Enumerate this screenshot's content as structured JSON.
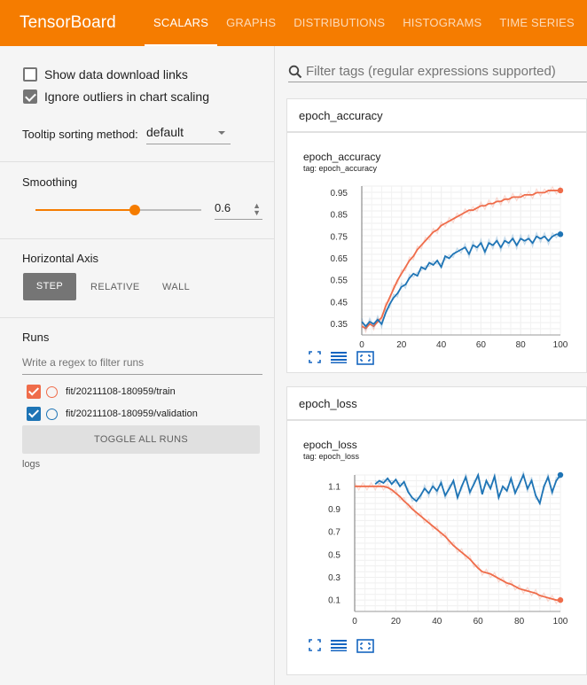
{
  "app": {
    "title": "TensorBoard"
  },
  "tabs": [
    {
      "label": "SCALARS",
      "active": true
    },
    {
      "label": "GRAPHS",
      "active": false
    },
    {
      "label": "DISTRIBUTIONS",
      "active": false
    },
    {
      "label": "HISTOGRAMS",
      "active": false
    },
    {
      "label": "TIME SERIES",
      "active": false
    }
  ],
  "sidebar": {
    "show_download_label": "Show data download links",
    "show_download_checked": false,
    "ignore_outliers_label": "Ignore outliers in chart scaling",
    "ignore_outliers_checked": true,
    "tooltip_label": "Tooltip sorting method:",
    "tooltip_value": "default",
    "smoothing_label": "Smoothing",
    "smoothing_value": "0.6",
    "smoothing_fraction": 0.6,
    "horizontal_axis_label": "Horizontal Axis",
    "axis_options": [
      "STEP",
      "RELATIVE",
      "WALL"
    ],
    "axis_selected": "STEP",
    "runs_label": "Runs",
    "runs_filter_placeholder": "Write a regex to filter runs",
    "runs": [
      {
        "name": "fit/20211108-180959/train",
        "color": "#ef6c4a",
        "checked": true
      },
      {
        "name": "fit/20211108-180959/validation",
        "color": "#1e74b5",
        "checked": true
      }
    ],
    "toggle_all_label": "TOGGLE ALL RUNS",
    "logs_label": "logs"
  },
  "main": {
    "search_placeholder": "Filter tags (regular expressions supported)"
  },
  "colors": {
    "accent": "#f57c00",
    "train": "#ef6c4a",
    "validation": "#1e74b5"
  },
  "chart_data": [
    {
      "type": "line",
      "group": "epoch_accuracy",
      "title": "epoch_accuracy",
      "subtitle": "tag: epoch_accuracy",
      "xlim": [
        0,
        100
      ],
      "ylim": [
        0.3,
        0.98
      ],
      "xticks": [
        0,
        20,
        40,
        60,
        80,
        100
      ],
      "yticks": [
        0.35,
        0.45,
        0.55,
        0.65,
        0.75,
        0.85,
        0.95
      ],
      "ytick_labels": [
        "0.35",
        "0.45",
        "0.55",
        "0.65",
        "0.75",
        "0.85",
        "0.95"
      ],
      "grid": true,
      "series": [
        {
          "name": "fit/20211108-180959/train",
          "color": "#ef6c4a",
          "x": [
            0,
            2,
            4,
            6,
            8,
            10,
            12,
            14,
            16,
            18,
            20,
            22,
            24,
            26,
            28,
            30,
            32,
            34,
            36,
            38,
            40,
            42,
            44,
            46,
            48,
            50,
            52,
            54,
            56,
            58,
            60,
            62,
            64,
            66,
            68,
            70,
            72,
            74,
            76,
            78,
            80,
            82,
            84,
            86,
            88,
            90,
            92,
            94,
            96,
            98,
            100
          ],
          "y": [
            0.34,
            0.33,
            0.35,
            0.34,
            0.36,
            0.38,
            0.43,
            0.47,
            0.51,
            0.55,
            0.58,
            0.61,
            0.64,
            0.66,
            0.69,
            0.71,
            0.73,
            0.75,
            0.77,
            0.78,
            0.8,
            0.81,
            0.82,
            0.83,
            0.84,
            0.85,
            0.86,
            0.87,
            0.87,
            0.88,
            0.89,
            0.89,
            0.9,
            0.9,
            0.91,
            0.91,
            0.92,
            0.92,
            0.93,
            0.93,
            0.93,
            0.94,
            0.94,
            0.94,
            0.95,
            0.95,
            0.95,
            0.96,
            0.96,
            0.96,
            0.96
          ]
        },
        {
          "name": "fit/20211108-180959/validation",
          "color": "#1e74b5",
          "x": [
            0,
            2,
            4,
            6,
            8,
            10,
            12,
            14,
            16,
            18,
            20,
            22,
            24,
            26,
            28,
            30,
            32,
            34,
            36,
            38,
            40,
            42,
            44,
            46,
            48,
            50,
            52,
            54,
            56,
            58,
            60,
            62,
            64,
            66,
            68,
            70,
            72,
            74,
            76,
            78,
            80,
            82,
            84,
            86,
            88,
            90,
            92,
            94,
            96,
            98,
            100
          ],
          "y": [
            0.36,
            0.34,
            0.36,
            0.35,
            0.37,
            0.35,
            0.4,
            0.44,
            0.47,
            0.49,
            0.52,
            0.53,
            0.56,
            0.58,
            0.57,
            0.61,
            0.6,
            0.63,
            0.62,
            0.64,
            0.61,
            0.66,
            0.65,
            0.67,
            0.68,
            0.69,
            0.7,
            0.67,
            0.71,
            0.7,
            0.72,
            0.68,
            0.72,
            0.71,
            0.73,
            0.7,
            0.73,
            0.72,
            0.74,
            0.71,
            0.74,
            0.73,
            0.74,
            0.72,
            0.75,
            0.74,
            0.75,
            0.73,
            0.75,
            0.76,
            0.76
          ]
        }
      ]
    },
    {
      "type": "line",
      "group": "epoch_loss",
      "title": "epoch_loss",
      "subtitle": "tag: epoch_loss",
      "xlim": [
        0,
        100
      ],
      "ylim": [
        0.0,
        1.2
      ],
      "xticks": [
        0,
        20,
        40,
        60,
        80,
        100
      ],
      "yticks": [
        0.1,
        0.3,
        0.5,
        0.7,
        0.9,
        1.1
      ],
      "ytick_labels": [
        "0.1",
        "0.3",
        "0.5",
        "0.7",
        "0.9",
        "1.1"
      ],
      "grid": true,
      "series": [
        {
          "name": "fit/20211108-180959/train",
          "color": "#ef6c4a",
          "x": [
            0,
            2,
            4,
            6,
            8,
            10,
            12,
            14,
            16,
            18,
            20,
            22,
            24,
            26,
            28,
            30,
            32,
            34,
            36,
            38,
            40,
            42,
            44,
            46,
            48,
            50,
            52,
            54,
            56,
            58,
            60,
            62,
            64,
            66,
            68,
            70,
            72,
            74,
            76,
            78,
            80,
            82,
            84,
            86,
            88,
            90,
            92,
            94,
            96,
            98,
            100
          ],
          "y": [
            1.1,
            1.1,
            1.1,
            1.1,
            1.1,
            1.1,
            1.1,
            1.1,
            1.09,
            1.07,
            1.04,
            1.01,
            0.97,
            0.94,
            0.9,
            0.87,
            0.84,
            0.81,
            0.78,
            0.75,
            0.72,
            0.69,
            0.66,
            0.62,
            0.58,
            0.55,
            0.52,
            0.49,
            0.46,
            0.42,
            0.38,
            0.35,
            0.34,
            0.33,
            0.31,
            0.29,
            0.27,
            0.25,
            0.24,
            0.22,
            0.2,
            0.19,
            0.18,
            0.17,
            0.16,
            0.14,
            0.13,
            0.12,
            0.11,
            0.1,
            0.1
          ]
        },
        {
          "name": "fit/20211108-180959/validation",
          "color": "#1e74b5",
          "x": [
            10,
            12,
            14,
            16,
            18,
            20,
            22,
            24,
            26,
            28,
            30,
            32,
            34,
            36,
            38,
            40,
            42,
            44,
            46,
            48,
            50,
            52,
            54,
            56,
            58,
            60,
            62,
            64,
            66,
            68,
            70,
            72,
            74,
            76,
            78,
            80,
            82,
            84,
            86,
            88,
            90,
            92,
            94,
            96,
            98,
            100
          ],
          "y": [
            1.12,
            1.15,
            1.13,
            1.17,
            1.12,
            1.16,
            1.1,
            1.14,
            1.05,
            1.0,
            0.97,
            1.02,
            1.08,
            1.04,
            1.1,
            1.06,
            1.13,
            1.02,
            1.08,
            1.15,
            1.0,
            1.1,
            1.18,
            1.05,
            1.12,
            1.2,
            1.03,
            1.15,
            1.08,
            1.19,
            1.0,
            1.1,
            1.06,
            1.17,
            1.04,
            1.12,
            1.2,
            1.08,
            1.15,
            1.02,
            0.95,
            1.1,
            1.18,
            1.05,
            1.15,
            1.22
          ]
        }
      ]
    }
  ]
}
